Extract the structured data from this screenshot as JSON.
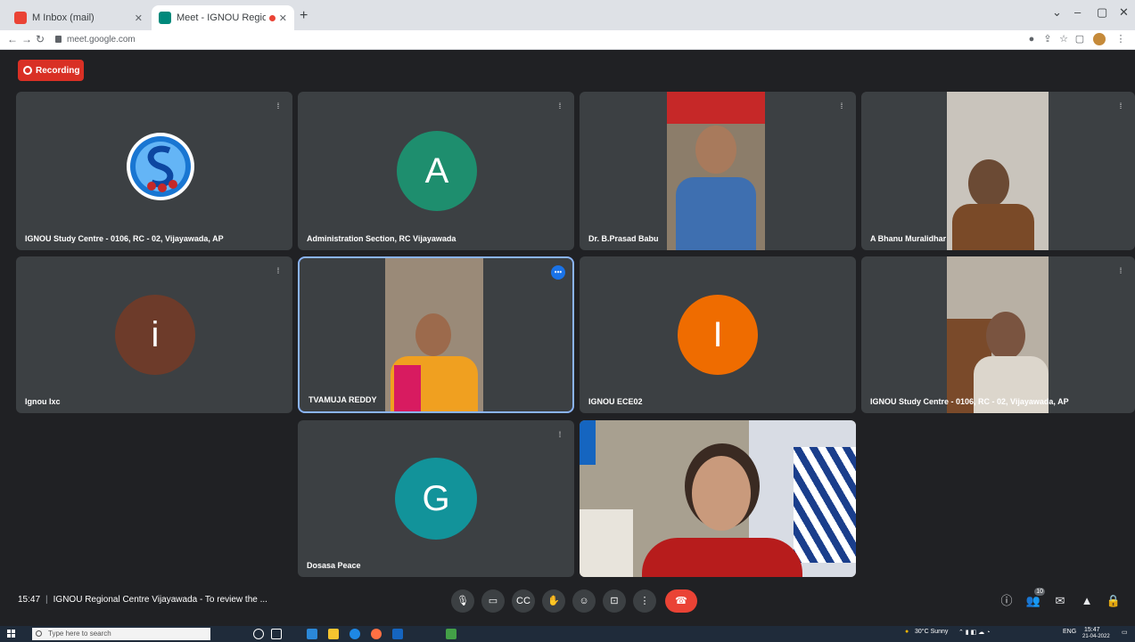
{
  "browser": {
    "tabs": [
      {
        "title": "M Inbox (mail)",
        "favicon_color": "#ea4335"
      },
      {
        "title": "Meet - IGNOU Regional Ce",
        "favicon_color": "#00897b"
      }
    ],
    "new_tab": "+",
    "url": "meet.google.com",
    "window_controls": [
      "⌄",
      "–",
      "▢",
      "✕"
    ]
  },
  "meet": {
    "recording_label": "Recording",
    "tiles": [
      {
        "name": "IGNOU Study Centre - 0106, RC - 02, Vijayawada, AP",
        "kind": "logo"
      },
      {
        "name": "Administration Section, RC Vijayawada",
        "kind": "avatar",
        "letter": "A",
        "color": "#1e8e6e"
      },
      {
        "name": "Dr. B.Prasad Babu",
        "kind": "video"
      },
      {
        "name": "A Bhanu Muralidhar",
        "kind": "video"
      },
      {
        "name": "Ignou Ixc",
        "kind": "avatar",
        "letter": "i",
        "color": "#6d3b2a"
      },
      {
        "name": "TVAMUJA REDDY",
        "kind": "video"
      },
      {
        "name": "IGNOU ECE02",
        "kind": "avatar",
        "letter": "I",
        "color": "#ef6c00"
      },
      {
        "name": "IGNOU Study Centre - 0106, RC - 02, Vijayawada, AP",
        "kind": "video"
      },
      {
        "name": "Dosasa Peace",
        "kind": "avatar",
        "letter": "G",
        "color": "#12939a"
      },
      {
        "name": "",
        "kind": "video"
      }
    ],
    "meeting_time": "15:47",
    "meeting_title": "IGNOU Regional Centre Vijayawada - To review the ...",
    "participants_count": "10"
  },
  "taskbar": {
    "search_placeholder": "Type here to search",
    "weather": "30°C Sunny",
    "lang": "ENG",
    "time": "15:47",
    "date": "21-04-2022"
  },
  "colors": {
    "meet_bg": "#202124",
    "tile_bg": "#3c4043",
    "end_call": "#ea4335",
    "recording": "#d93025"
  }
}
